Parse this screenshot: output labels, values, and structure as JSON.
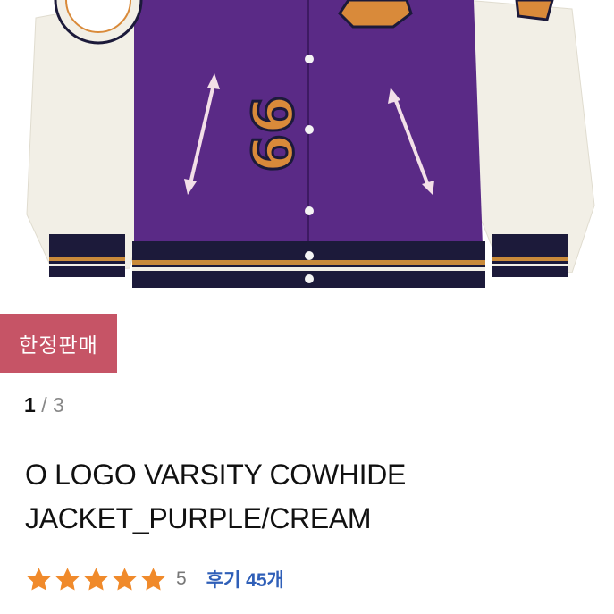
{
  "product": {
    "image": {
      "icon": "jacket-image"
    },
    "badge": "한정판매",
    "pager": {
      "current": "1",
      "separator": "/",
      "total": "3"
    },
    "title_line1": "O LOGO VARSITY COWHIDE",
    "title_line2": "JACKET_PURPLE/CREAM",
    "rating": {
      "value": "5",
      "stars": 5,
      "star_color": "#f08a2b"
    },
    "reviews_label": "후기 45개"
  },
  "colors": {
    "badge_bg": "#c65466",
    "link_blue": "#2f5fb8",
    "jacket_purple": "#5a2a86",
    "sleeve_cream": "#f2efe6"
  }
}
